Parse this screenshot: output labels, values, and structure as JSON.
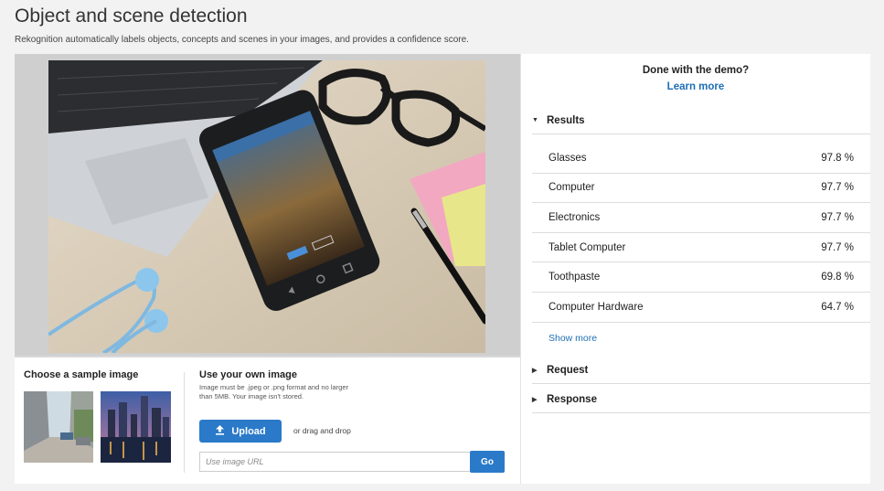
{
  "page": {
    "title": "Object and scene detection",
    "subtitle": "Rekognition automatically labels objects, concepts and scenes in your images, and provides a confidence score."
  },
  "sample": {
    "heading": "Choose a sample image"
  },
  "upload": {
    "heading": "Use your own image",
    "note": "Image must be .jpeg or .png format and no larger than 5MB. Your image isn't stored.",
    "button_label": "Upload",
    "drag_text": "or drag and drop",
    "url_placeholder": "Use image URL",
    "go_label": "Go",
    "icon": "upload-icon"
  },
  "right_panel": {
    "prompt": "Done with the demo?",
    "learn_more": "Learn more",
    "results_header": "Results",
    "results": [
      {
        "label": "Glasses",
        "confidence": "97.8 %"
      },
      {
        "label": "Computer",
        "confidence": "97.7 %"
      },
      {
        "label": "Electronics",
        "confidence": "97.7 %"
      },
      {
        "label": "Tablet Computer",
        "confidence": "97.7 %"
      },
      {
        "label": "Toothpaste",
        "confidence": "69.8 %"
      },
      {
        "label": "Computer Hardware",
        "confidence": "64.7 %"
      }
    ],
    "show_more": "Show more",
    "request_header": "Request",
    "response_header": "Response"
  },
  "colors": {
    "accent": "#2a7ac9",
    "link": "#1f6fb5",
    "background": "#f2f2f2"
  }
}
